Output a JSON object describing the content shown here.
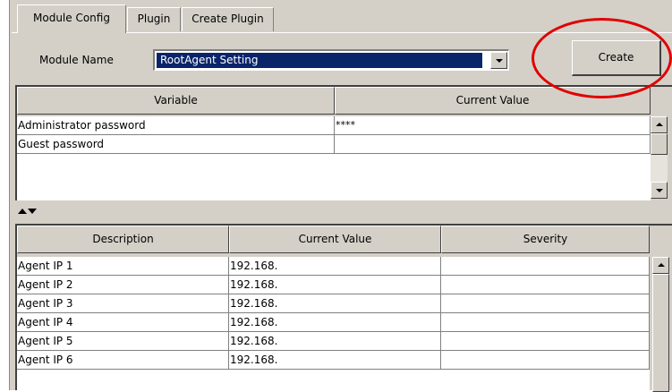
{
  "tabs": [
    {
      "label": "Module Config",
      "active": true
    },
    {
      "label": "Plugin",
      "active": false
    },
    {
      "label": "Create Plugin",
      "active": false
    }
  ],
  "module": {
    "label": "Module Name",
    "selected": "RootAgent Setting"
  },
  "create_button": "Create",
  "annotation": {
    "callout_color": "#e00000",
    "target": "create-button"
  },
  "variables_table": {
    "headers": [
      "Variable",
      "Current Value"
    ],
    "rows": [
      {
        "variable": "Administrator password",
        "value": "****"
      },
      {
        "variable": "Guest password",
        "value": ""
      }
    ]
  },
  "divider_icons": [
    "split-up-icon",
    "split-down-icon"
  ],
  "agents_table": {
    "headers": [
      "Description",
      "Current Value",
      "Severity"
    ],
    "rows": [
      {
        "description": "Agent IP 1",
        "value": "192.168.",
        "severity": ""
      },
      {
        "description": "Agent IP 2",
        "value": "192.168.",
        "severity": ""
      },
      {
        "description": "Agent IP 3",
        "value": "192.168.",
        "severity": ""
      },
      {
        "description": "Agent IP 4",
        "value": "192.168.",
        "severity": ""
      },
      {
        "description": "Agent IP 5",
        "value": "192.168.",
        "severity": ""
      },
      {
        "description": "Agent IP 6",
        "value": "192.168.",
        "severity": ""
      }
    ]
  },
  "colors": {
    "panel": "#d4d0c8",
    "selection": "#0a246a",
    "callout": "#e00000"
  }
}
